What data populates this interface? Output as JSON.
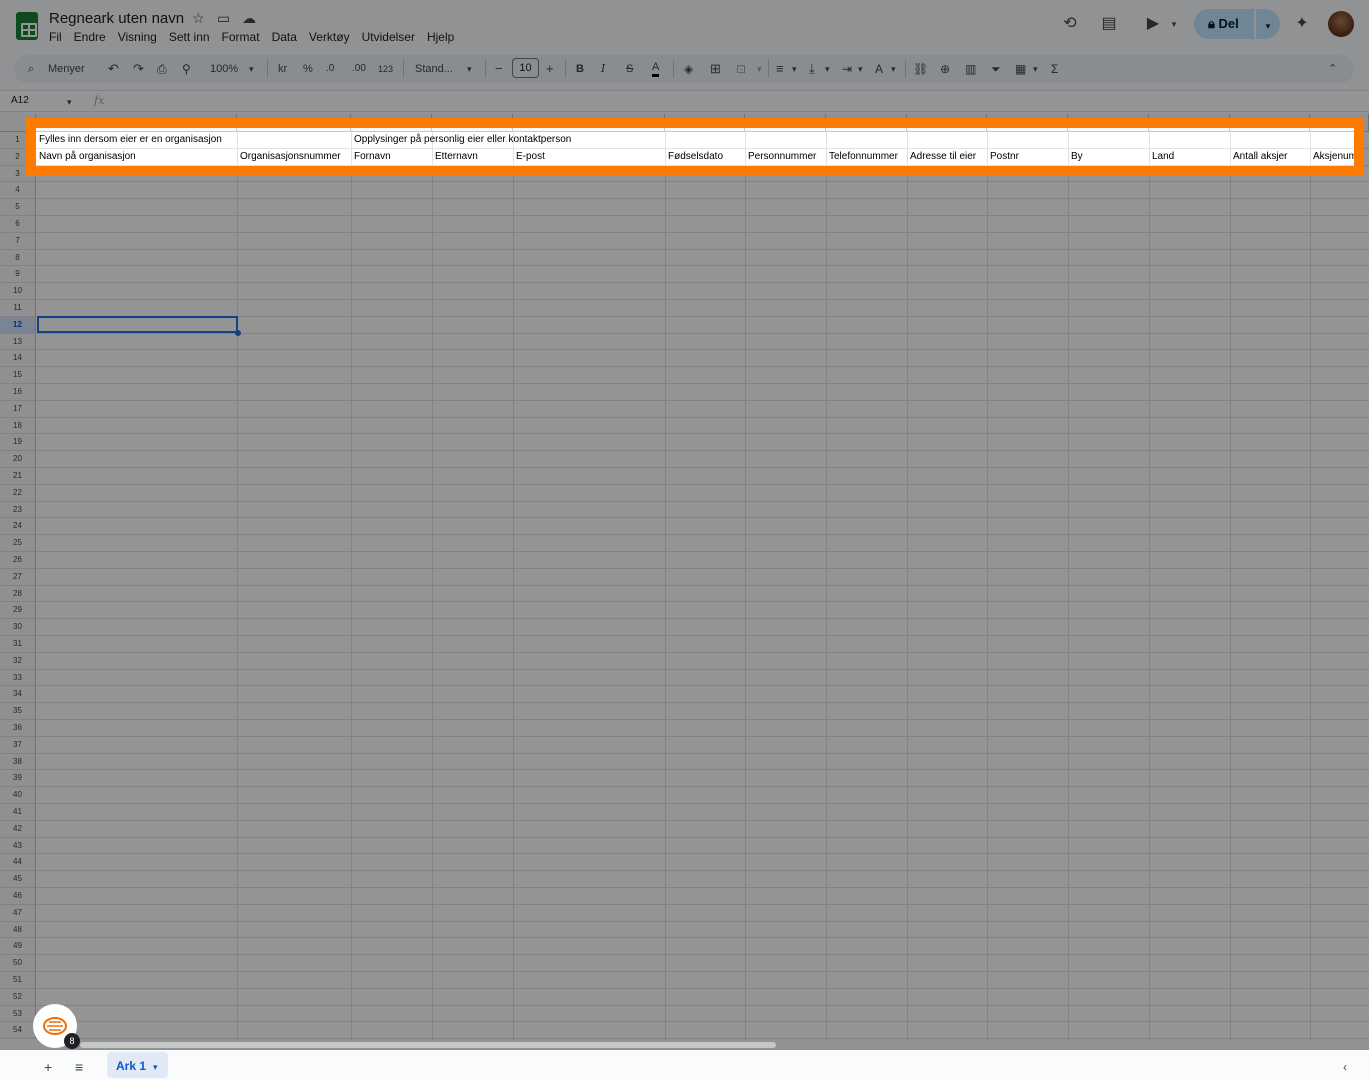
{
  "app": {
    "title": "Regneark uten navn",
    "menus": [
      "Fil",
      "Endre",
      "Visning",
      "Sett inn",
      "Format",
      "Data",
      "Verktøy",
      "Utvidelser",
      "Hjelp"
    ],
    "share_label": "Del"
  },
  "toolbar": {
    "search_label": "Menyer",
    "zoom": "100%",
    "currency": "kr",
    "percent": "%",
    "decimal_decrease": ".0",
    "decimal_increase": ".00",
    "number_format": "123",
    "font": "Stand...",
    "font_size": "10",
    "bold": "B",
    "italic": "I",
    "strike": "S",
    "text_color": "A",
    "sum": "Σ"
  },
  "formula_bar": {
    "cell_ref": "A12",
    "fx": "fx"
  },
  "sheet": {
    "row_numbers": [
      "1",
      "2",
      "3",
      "4",
      "5",
      "6",
      "7",
      "8",
      "9",
      "10",
      "11",
      "12",
      "13",
      "14",
      "15",
      "16",
      "17",
      "18",
      "19",
      "20",
      "21",
      "22",
      "23",
      "24",
      "25",
      "26",
      "27",
      "28",
      "29",
      "30",
      "31",
      "32",
      "33",
      "34",
      "35",
      "36",
      "37",
      "38",
      "39",
      "40",
      "41",
      "42",
      "43",
      "44",
      "45",
      "46",
      "47",
      "48",
      "49",
      "50",
      "51",
      "52",
      "53",
      "54"
    ],
    "selected_row": "12",
    "row1": {
      "a": "Fylles inn dersom eier er en organisasjon",
      "c": "Opplysinger på personlig eier eller kontaktperson"
    },
    "row2": [
      "Navn på organisasjon",
      "Organisasjonsnummer",
      "Fornavn",
      "Etternavn",
      "E-post",
      "Fødselsdato",
      "Personnummer",
      "Telefonnummer",
      "Adresse til eier",
      "Postnr",
      "By",
      "Land",
      "Antall aksjer",
      "Aksjenummer"
    ]
  },
  "bottom": {
    "sheet_tab": "Ark 1",
    "badge_count": "8"
  },
  "colors": {
    "highlight": "#ff7a00",
    "selection": "#1a73e8",
    "share_bg": "#c2e7ff"
  }
}
